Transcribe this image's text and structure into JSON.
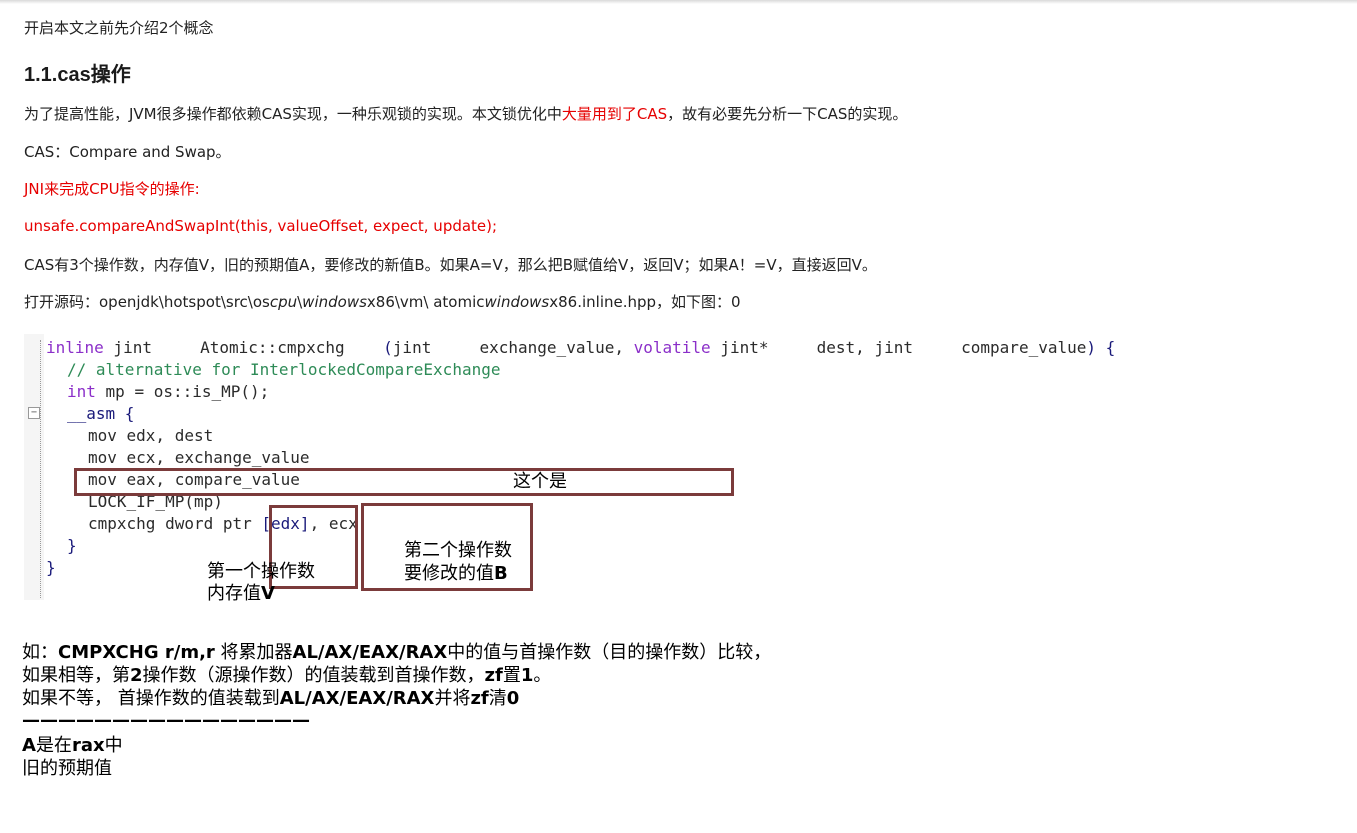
{
  "intro": "开启本文之前先介绍2个概念",
  "heading": "1.1.cas操作",
  "para1": {
    "before": "为了提高性能，JVM很多操作都依赖CAS实现，一种乐观锁的实现。本文锁优化中",
    "highlight": "大量用到了CAS",
    "after": "，故有必要先分析一下CAS的实现。"
  },
  "cas_def": "CAS：Compare and Swap。",
  "jni_line": "JNI来完成CPU指令的操作:",
  "unsafe_call": "unsafe.compareAndSwapInt(this, valueOffset, expect, update);",
  "cas_operands": "CAS有3个操作数，内存值V，旧的预期值A，要修改的新值B。如果A=V，那么把B赋值给V，返回V；如果A！=V，直接返回V。",
  "source_path": {
    "part1": "打开源码：openjdk\\hotspot\\src\\os",
    "it1": "cpu",
    "part2": "\\",
    "it2": "windows",
    "part3": "x86\\vm\\ atomic",
    "it3": "windows",
    "part4": "x86.inline.hpp，如下图：0"
  },
  "code": {
    "line1_kw1": "inline",
    "line1_rest1": " jint     Atomic::cmpxchg    ",
    "line1_paren": "(",
    "line1_rest2": "jint     exchange_value, ",
    "line1_kw2": "volatile",
    "line1_rest3": " jint*     dest, jint     compare_value",
    "line1_end": ") {",
    "line2": "// alternative for InterlockedCompareExchange",
    "line3_kw": "int",
    "line3_rest": " mp = os::is_MP();",
    "line4": "__asm {",
    "line5": "mov edx, dest",
    "line6": "mov ecx, exchange_value",
    "line7": "mov eax, compare_value",
    "line8": "LOCK_IF_MP(mp)",
    "line9_a": "cmpxchg dword ptr ",
    "line9_b": "[edx]",
    "line9_c": ", ecx",
    "line10": "}",
    "line11": "}",
    "fold_symbol": "−"
  },
  "annotations": {
    "this_one": "这个是",
    "first_operand_l1": "第一个操作数",
    "first_operand_l2_a": "内存值",
    "first_operand_l2_b": "V",
    "second_operand_l1": "第二个操作数",
    "second_operand_l2_a": "要修改的值",
    "second_operand_l2_b": "B"
  },
  "notes": {
    "line1_a": "如：",
    "line1_b": "CMPXCHG r/m,r",
    "line1_c": " 将累加器",
    "line1_d": "AL/AX/EAX/RAX",
    "line1_e": "中的值与首操作数（目的操作数）比较，",
    "line2_a": "如果相等，第",
    "line2_b": "2",
    "line2_c": "操作数（源操作数）的值装载到首操作数，",
    "line2_d": "zf",
    "line2_e": "置",
    "line2_f": "1",
    "line2_g": "。",
    "line3_a": "如果不等， 首操作数的值装载到",
    "line3_b": "AL/AX/EAX/RAX",
    "line3_c": "并将",
    "line3_d": "zf",
    "line3_e": "清",
    "line3_f": "0",
    "divider": "————————————————",
    "line4_a": "A",
    "line4_b": "是在",
    "line4_c": "rax",
    "line4_d": "中",
    "line5": "旧的预期值"
  }
}
